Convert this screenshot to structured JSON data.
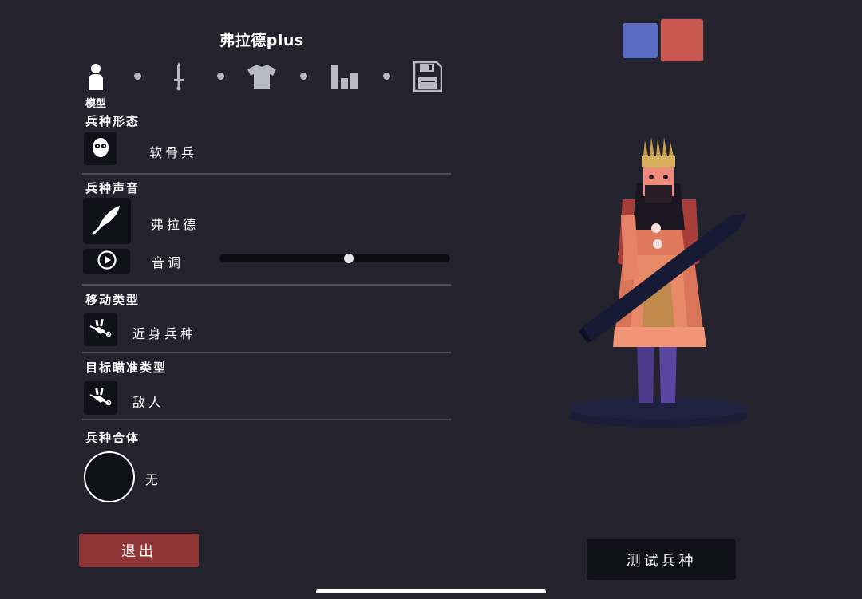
{
  "header": {
    "title": "弗拉德plus"
  },
  "steps": {
    "items": [
      {
        "icon": "person-icon",
        "label": "模型",
        "active": true
      },
      {
        "icon": "sword-icon",
        "active": false
      },
      {
        "icon": "shirt-icon",
        "active": false
      },
      {
        "icon": "stats-icon",
        "active": false
      },
      {
        "icon": "save-icon",
        "active": false
      }
    ]
  },
  "sections": {
    "form": {
      "title": "兵种形态",
      "value": "软骨兵",
      "icon": "skull-face-icon"
    },
    "voice": {
      "title": "兵种声音",
      "value": "弗拉德",
      "icon": "feather-icon",
      "pitch_label": "音调",
      "pitch_icon": "play-icon",
      "pitch_level": 0.56
    },
    "movement": {
      "title": "移动类型",
      "value": "近身兵种",
      "icon": "melee-icon"
    },
    "targeting": {
      "title": "目标瞄准类型",
      "value": "敌人",
      "icon": "target-icon"
    },
    "merge": {
      "title": "兵种合体",
      "value": "无"
    }
  },
  "buttons": {
    "exit": "退出",
    "test": "测试兵种"
  },
  "team_colors": {
    "blue": "#5a6bc4",
    "red": "#c95752"
  },
  "theme": {
    "background": "#23222d",
    "panel": "#101018",
    "exit": "#8e3636"
  }
}
